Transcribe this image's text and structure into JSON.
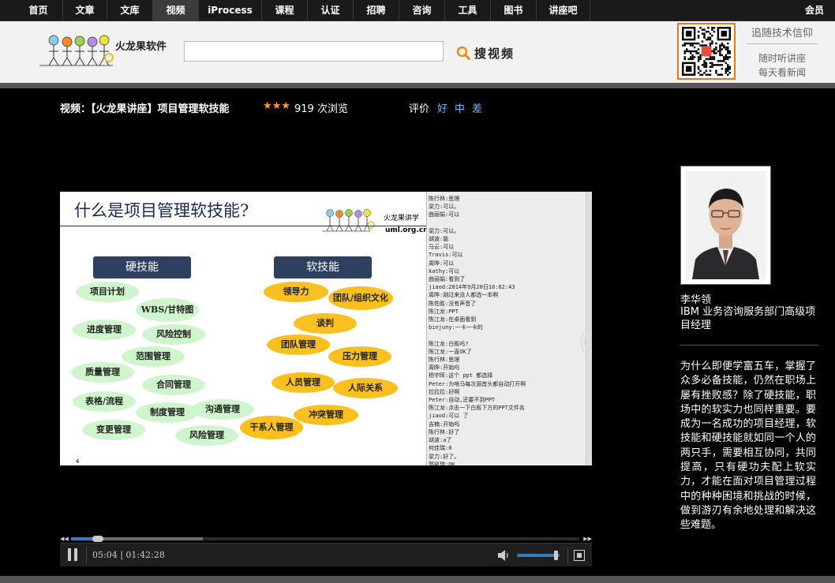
{
  "nav": {
    "items": [
      "首页",
      "文章",
      "文库",
      "视频",
      "iProcess",
      "课程",
      "认证",
      "招聘",
      "咨询",
      "工具",
      "图书",
      "讲座吧"
    ],
    "active_index": 3,
    "member": "会员"
  },
  "header": {
    "logo_text": "火龙果软件",
    "search_placeholder": "",
    "search_label": "搜视频",
    "follow_text": "追随技术信仰",
    "slogan_1": "随时听讲座",
    "slogan_2": "每天看新闻"
  },
  "video_info": {
    "title_label": "视频：",
    "title": "【火龙果讲座】项目管理软技能",
    "stars": "★★★",
    "views": "919 次浏览",
    "rate_label": "评价",
    "rate_good": "好",
    "rate_mid": "中",
    "rate_bad": "差"
  },
  "slide": {
    "title": "什么是项目管理软技能?",
    "brand": "火龙果讲学",
    "url": "uml.org.cn",
    "hard_head": "硬技能",
    "soft_head": "软技能",
    "hard_items": [
      "项目计划",
      "WBS/甘特图",
      "进度管理",
      "风险控制",
      "范围管理",
      "质量管理",
      "合同管理",
      "表格/流程",
      "制度管理",
      "沟通管理",
      "变更管理",
      "风险管理"
    ],
    "soft_items": [
      "领导力",
      "团队/组织文化",
      "谈判",
      "团队管理",
      "压力管理",
      "人员管理",
      "人际关系",
      "干系人管理",
      "冲突管理"
    ],
    "page_num": "4"
  },
  "chat": [
    "陈行林:思理",
    "      梁力:可以。",
    "    曲丽娟:可以",
    "",
    "      梁力:可以。",
    "      胡波:能",
    "马云:可以",
    "    Travis:可以",
    "周晔:可以",
    "     kathy:可以",
    "    曲丽娟:看到了",
    "jiaod:2014年9月20日10:02:43",
    "周晔:刚过来没人都选一本啊",
    "陈佐胜:没有声音了",
    "     陈江龙:PPT",
    "     陈江龙:在桌面看到",
    "binjuny:一卡一卡的",
    "",
    "    陈江龙:白板吗?",
    "    陈江龙:一直OK了",
    "陈行林:思理",
    "周晔:开始吗",
    "杨宇晖:这个 ppt 都选择",
    "      Peter:为啥马每次源首头都自动打开啊",
    "拉拉拉:好啊",
    "      Peter:自动,还要不到PPT",
    "    陈江龙:点击一下白板下方的PPT文件名",
    "jiaod:可以 了",
    "吉楠:开始吗",
    "陈行林:好了",
    "      胡波:a了",
    "何佳瑞:0",
    "      梁力:好了。",
    "郭凯瑞:OK"
  ],
  "player": {
    "current_time": "05:04",
    "separator": "|",
    "total_time": "01:42:28",
    "played_fraction": 0.049,
    "buffered_fraction": 0.26,
    "volume_fraction": 0.9
  },
  "speaker": {
    "name": "李华领",
    "title": "IBM 业务咨询服务部门高级项目经理",
    "description": "为什么即便学富五车，掌握了众多必备技能，仍然在职场上屡有挫败感？除了硬技能，职场中的软实力也同样重要。要成为一名成功的项目经理，软技能和硬技能就如同一个人的两只手，需要相互协同，共同提高，只有硬功夫配上软实力，才能在面对项目管理过程中的种种困境和挑战的时候，做到游刃有余地处理和解决这些难题。"
  },
  "colors": {
    "accent_orange": "#e87722",
    "star": "#ff9a2e",
    "rate_link": "#6fb6ff",
    "progress": "#2f7fc0"
  }
}
